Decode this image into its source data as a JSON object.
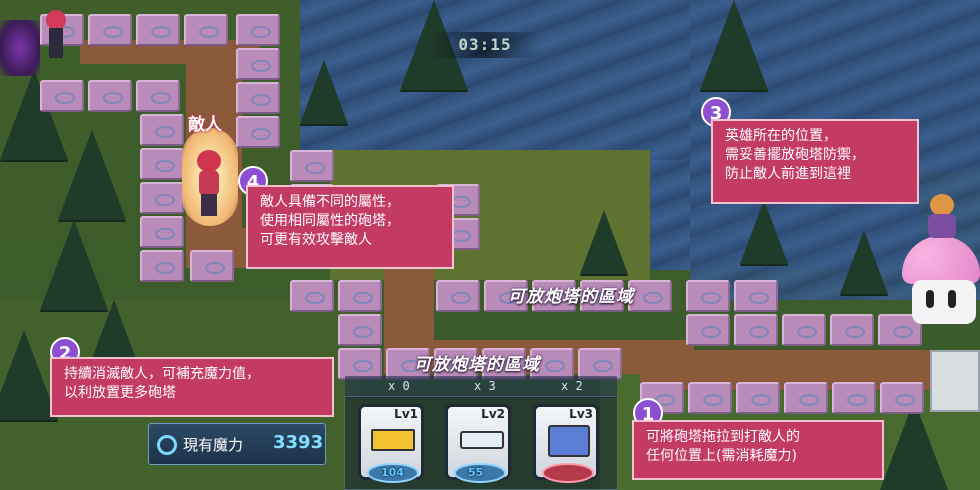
{
  "hud": {
    "timer": "03:15",
    "mana_label": "現有魔力",
    "mana_value": "3393"
  },
  "map": {
    "zone_label_1": "可放炮塔的區域",
    "zone_label_2": "可放炮塔的區域",
    "enemy_label": "敵人"
  },
  "tower_counts": [
    "x 0",
    "x 3",
    "x 2"
  ],
  "towers": [
    {
      "level": "Lv1",
      "cost": "104"
    },
    {
      "level": "Lv2",
      "cost": "55"
    },
    {
      "level": "Lv3",
      "cost": ""
    }
  ],
  "callouts": [
    {
      "number": "1",
      "lines": [
        "可將砲塔拖拉到打敵人的",
        "任何位置上(需消耗魔力)"
      ]
    },
    {
      "number": "2",
      "lines": [
        "持續消滅敵人，可補充魔力值，",
        "以利放置更多砲塔"
      ]
    },
    {
      "number": "3",
      "lines": [
        "英雄所在的位置，",
        "需妥善擺放砲塔防禦，",
        "防止敵人前進到這裡"
      ]
    },
    {
      "number": "4",
      "lines": [
        "敵人具備不同的屬性，",
        "使用相同屬性的砲塔，",
        "可更有效攻擊敵人"
      ]
    }
  ],
  "colors": {
    "callout_bg": "#c33a64",
    "number_badge": "#8d4fd1",
    "tile": "#b98bb9",
    "water": "#3b5f8e"
  }
}
